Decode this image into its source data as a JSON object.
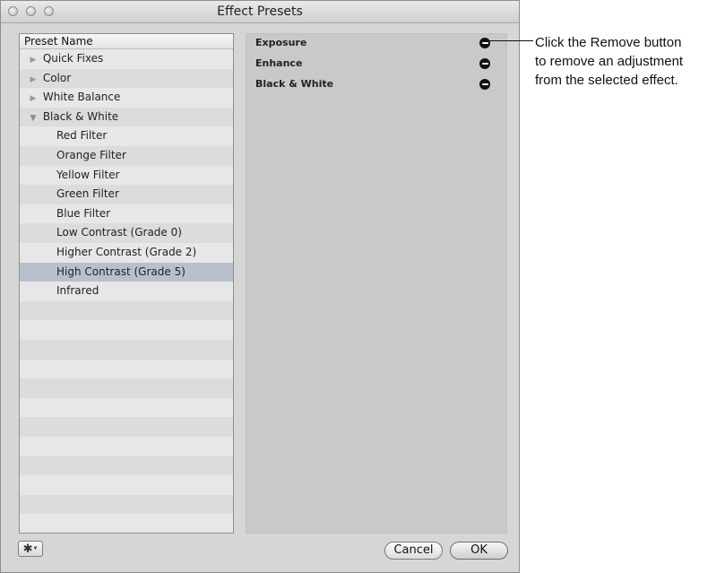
{
  "window": {
    "title": "Effect Presets"
  },
  "presets": {
    "header": "Preset Name",
    "rows": [
      {
        "label": "Quick Fixes",
        "disclosure": "▶"
      },
      {
        "label": "Color",
        "disclosure": "▶"
      },
      {
        "label": "White Balance",
        "disclosure": "▶"
      },
      {
        "label": "Black & White",
        "disclosure": "▼"
      },
      {
        "label": "Red Filter"
      },
      {
        "label": "Orange Filter"
      },
      {
        "label": "Yellow Filter"
      },
      {
        "label": "Green Filter"
      },
      {
        "label": "Blue Filter"
      },
      {
        "label": "Low Contrast (Grade 0)"
      },
      {
        "label": "Higher Contrast (Grade 2)"
      },
      {
        "label": "High Contrast (Grade 5)",
        "selected": true
      },
      {
        "label": "Infrared"
      }
    ]
  },
  "adjustments": [
    {
      "label": "Exposure"
    },
    {
      "label": "Enhance"
    },
    {
      "label": "Black & White"
    }
  ],
  "buttons": {
    "cancel": "Cancel",
    "ok": "OK"
  },
  "callout": {
    "line1": "Click the Remove button",
    "line2": "to remove an adjustment",
    "line3": "from the selected effect."
  },
  "icons": {
    "gear": "gear-icon",
    "remove": "remove-icon"
  },
  "colors": {
    "selected_row": "#b8c0cd",
    "window_bg": "#d6d6d6"
  }
}
